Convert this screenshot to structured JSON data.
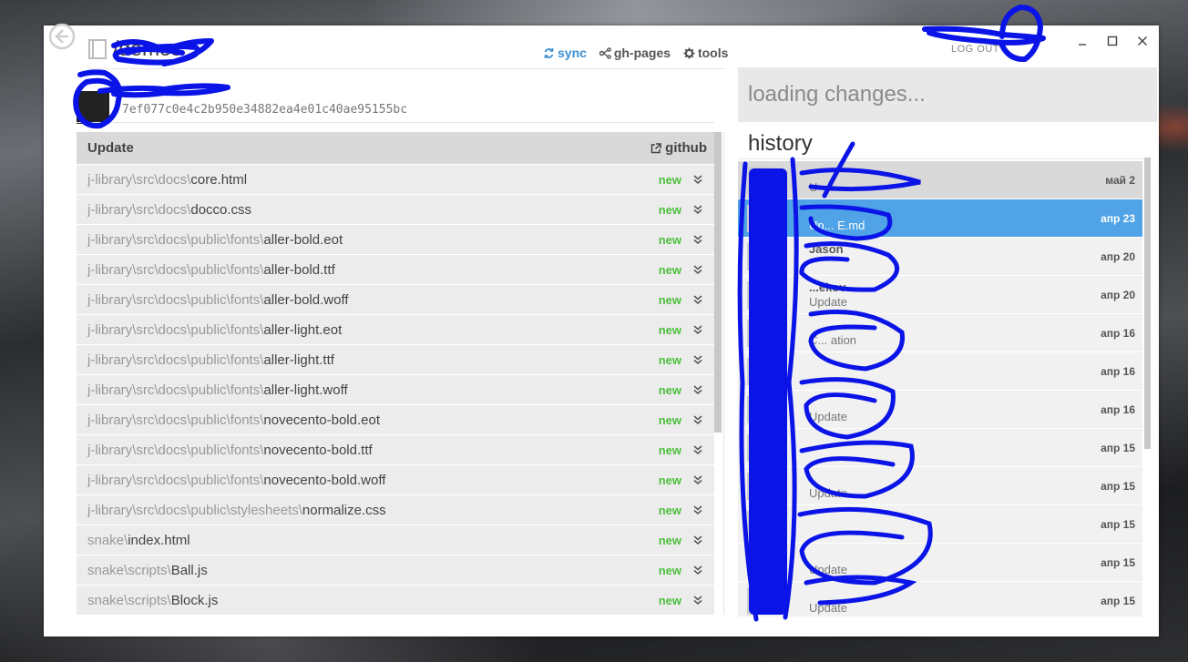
{
  "window": {
    "repo_owner": "",
    "repo_name": "/demos",
    "logout_label": "LOG OUT"
  },
  "top_links": {
    "sync": "sync",
    "gh_pages": "gh-pages",
    "tools": "tools"
  },
  "commit": {
    "label": "",
    "sha": "7ef077c0e4c2b950e34882ea4e01c40ae95155bc"
  },
  "files": {
    "header_title": "Update",
    "github_link": "github",
    "rows": [
      {
        "dir": "j-library\\src\\docs\\",
        "name": "core.html",
        "status": "new"
      },
      {
        "dir": "j-library\\src\\docs\\",
        "name": "docco.css",
        "status": "new"
      },
      {
        "dir": "j-library\\src\\docs\\public\\fonts\\",
        "name": "aller-bold.eot",
        "status": "new"
      },
      {
        "dir": "j-library\\src\\docs\\public\\fonts\\",
        "name": "aller-bold.ttf",
        "status": "new"
      },
      {
        "dir": "j-library\\src\\docs\\public\\fonts\\",
        "name": "aller-bold.woff",
        "status": "new"
      },
      {
        "dir": "j-library\\src\\docs\\public\\fonts\\",
        "name": "aller-light.eot",
        "status": "new"
      },
      {
        "dir": "j-library\\src\\docs\\public\\fonts\\",
        "name": "aller-light.ttf",
        "status": "new"
      },
      {
        "dir": "j-library\\src\\docs\\public\\fonts\\",
        "name": "aller-light.woff",
        "status": "new"
      },
      {
        "dir": "j-library\\src\\docs\\public\\fonts\\",
        "name": "novecento-bold.eot",
        "status": "new"
      },
      {
        "dir": "j-library\\src\\docs\\public\\fonts\\",
        "name": "novecento-bold.ttf",
        "status": "new"
      },
      {
        "dir": "j-library\\src\\docs\\public\\fonts\\",
        "name": "novecento-bold.woff",
        "status": "new"
      },
      {
        "dir": "j-library\\src\\docs\\public\\stylesheets\\",
        "name": "normalize.css",
        "status": "new"
      },
      {
        "dir": "snake\\",
        "name": "index.html",
        "status": "new"
      },
      {
        "dir": "snake\\scripts\\",
        "name": "Ball.js",
        "status": "new"
      },
      {
        "dir": "snake\\scripts\\",
        "name": "Block.js",
        "status": "new"
      }
    ]
  },
  "changes": {
    "loading_text": "loading changes..."
  },
  "history": {
    "title": "history",
    "rows": [
      {
        "author": "",
        "message": "U",
        "date": "май 2",
        "state": "first"
      },
      {
        "author": "",
        "message": "Up... E.md",
        "date": "апр 23",
        "state": "selected"
      },
      {
        "author": "Jason",
        "message": "",
        "date": "апр 20",
        "state": "normal"
      },
      {
        "author": "...ekov",
        "message": "Update",
        "date": "апр 20",
        "state": "normal"
      },
      {
        "author": "",
        "message": "C... ation",
        "date": "апр 16",
        "state": "normal"
      },
      {
        "author": "",
        "message": "",
        "date": "апр 16",
        "state": "normal"
      },
      {
        "author": "",
        "message": "Update",
        "date": "апр 16",
        "state": "normal"
      },
      {
        "author": "",
        "message": "",
        "date": "апр 15",
        "state": "normal"
      },
      {
        "author": "",
        "message": "Update",
        "date": "апр 15",
        "state": "normal"
      },
      {
        "author": "",
        "message": "",
        "date": "апр 15",
        "state": "normal"
      },
      {
        "author": "",
        "message": "Update",
        "date": "апр 15",
        "state": "normal"
      },
      {
        "author": "",
        "message": "Update",
        "date": "апр 15",
        "state": "normal"
      }
    ]
  },
  "colors": {
    "accent": "#4fa3e6",
    "status_new": "#4cbf3c",
    "scribble": "#0a14e6"
  }
}
